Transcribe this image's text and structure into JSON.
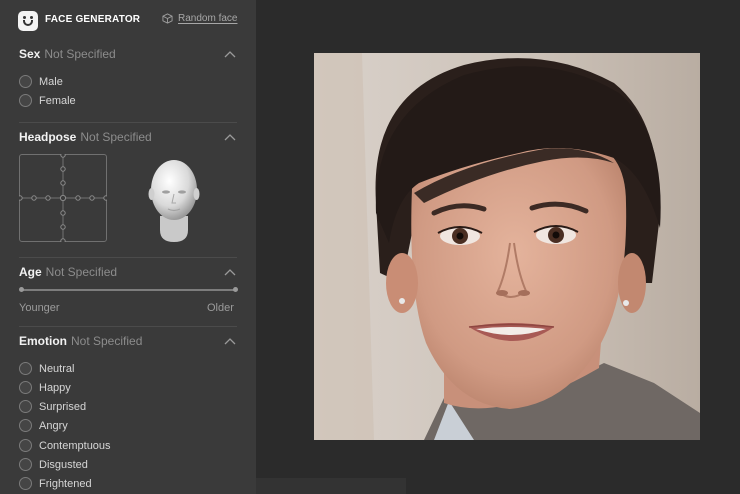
{
  "header": {
    "brand": "FACE GENERATOR",
    "random_label": "Random face"
  },
  "sex": {
    "title": "Sex",
    "value": "Not Specified",
    "options": [
      "Male",
      "Female"
    ]
  },
  "headpose": {
    "title": "Headpose",
    "value": "Not Specified"
  },
  "age": {
    "title": "Age",
    "value": "Not Specified",
    "min_label": "Younger",
    "max_label": "Older"
  },
  "emotion": {
    "title": "Emotion",
    "value": "Not Specified",
    "options": [
      "Neutral",
      "Happy",
      "Surprised",
      "Angry",
      "Contemptuous",
      "Disgusted",
      "Frightened"
    ]
  },
  "colors": {
    "sidebar_bg": "#3a3a3a",
    "page_bg": "#2b2b2b",
    "muted_text": "#8c8c8c"
  },
  "icons": {
    "logo": "smiley-face-icon",
    "random": "cube-icon",
    "collapse": "chevron-up-icon"
  }
}
